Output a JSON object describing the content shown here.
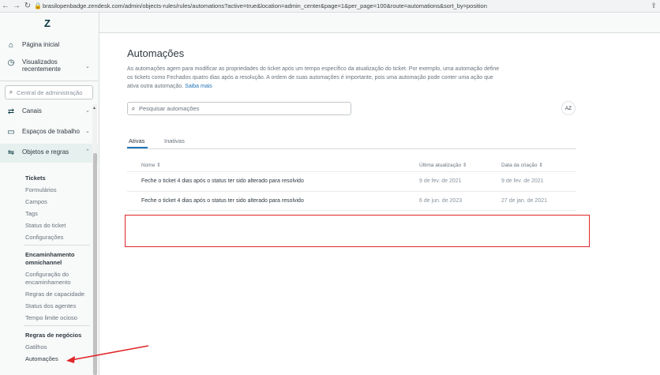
{
  "browser": {
    "url": "brasilopenbadge.zendesk.com/admin/objects-rules/rules/automations?active=true&location=admin_center&page=1&per_page=100&route=automations&sort_by=position"
  },
  "sidebar": {
    "home": "Página inicial",
    "recent_line1": "Visualizados",
    "recent_line2": "recentemente",
    "search_placeholder": "Central de administração",
    "channels": "Canais",
    "workspaces": "Espaços de trabalho",
    "objects_rules": "Objetos e regras",
    "tickets_head": "Tickets",
    "forms": "Formulários",
    "fields": "Campos",
    "tags": "Tags",
    "ticket_status": "Status do ticket",
    "settings": "Configurações",
    "routing_head_1": "Encaminhamento",
    "routing_head_2": "omnichannel",
    "routing_config_1": "Configuração do",
    "routing_config_2": "encaminhamento",
    "capacity_rules": "Regras de capacidade",
    "agent_status": "Status dos agentes",
    "idle_timeout": "Tempo limite ocioso",
    "business_rules_head": "Regras de negócios",
    "triggers": "Gatilhos",
    "automations": "Automações"
  },
  "main": {
    "title": "Automações",
    "description": "As automações agem para modificar as propriedades do ticket após um tempo específico da atualização do ticket. Por exemplo, uma automação define os tickets como Fechados quatro dias após a resolução. A ordem de suas automações é importante, pois uma automação pode conter uma ação que ativa outra automação.",
    "learn_more": "Saiba mais",
    "search_placeholder": "Pesquisar automações",
    "sort_icon_label": "AZ",
    "tabs": [
      "Ativas",
      "Inativas"
    ],
    "columns": [
      "Nome ⇕",
      "Última atualização ⇕",
      "Data da criação ⇕"
    ],
    "rows": [
      {
        "name": "Feche o ticket 4 dias após o status ter sido alterado para resolvido",
        "updated": "9 de fev. de 2021",
        "created": "9 de fev. de 2021"
      },
      {
        "name": "Feche o ticket 4 dias após o status ter sido alterado para resolvido",
        "updated": "6 de jun. de 2023",
        "created": "27 de jan. de 2021"
      }
    ]
  },
  "colors": {
    "accent": "#1f73b7",
    "highlight": "#e0262a"
  }
}
